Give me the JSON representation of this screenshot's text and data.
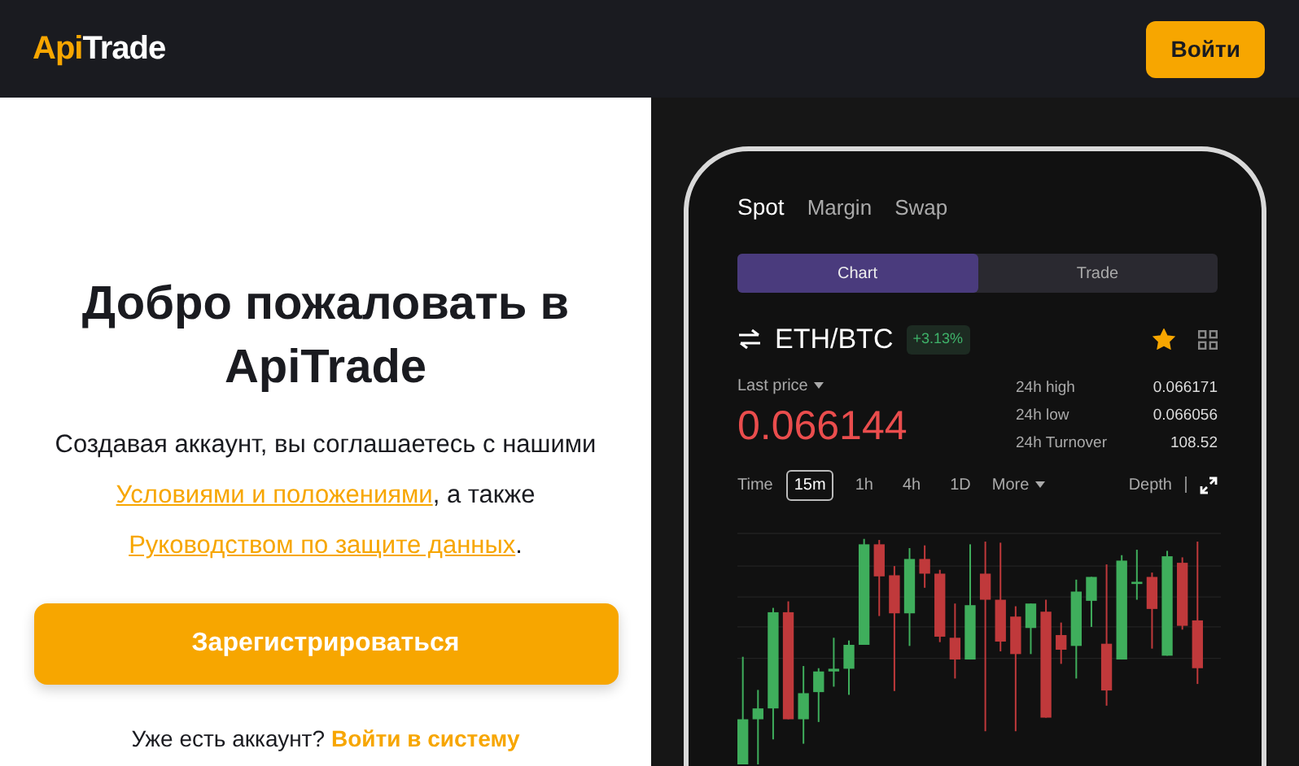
{
  "header": {
    "logo": {
      "accent": "Api",
      "rest": "Trade"
    },
    "login_button": "Войти"
  },
  "welcome": {
    "title": "Добро пожаловать в ApiTrade",
    "terms": [
      {
        "kind": "text",
        "text": "Создавая аккаунт, вы соглашаетесь с нашими "
      },
      {
        "kind": "link",
        "text": "Условиями и положениями"
      },
      {
        "kind": "text",
        "text": ", а также "
      },
      {
        "kind": "link",
        "text": "Руководством по защите данных"
      },
      {
        "kind": "text",
        "text": "."
      }
    ],
    "register_button": "Зарегистрироваться",
    "signin_prompt": "Уже есть аккаунт?",
    "signin_link": "Войти в систему"
  },
  "phone": {
    "tabs": [
      {
        "label": "Spot",
        "selected": true
      },
      {
        "label": "Margin",
        "selected": false
      },
      {
        "label": "Swap",
        "selected": false
      }
    ],
    "segments": [
      {
        "label": "Chart",
        "selected": true
      },
      {
        "label": "Trade",
        "selected": false
      }
    ],
    "pair": "ETH/BTC",
    "change": "+3.13%",
    "favorite": true,
    "last_price_label": "Last price",
    "last_price": "0.066144",
    "stats": [
      {
        "label": "24h high",
        "value": "0.066171"
      },
      {
        "label": "24h low",
        "value": "0.066056"
      },
      {
        "label": "24h Turnover",
        "value": "108.52"
      }
    ],
    "time_label": "Time",
    "intervals": [
      {
        "label": "15m",
        "selected": true
      },
      {
        "label": "1h",
        "selected": false
      },
      {
        "label": "4h",
        "selected": false
      },
      {
        "label": "1D",
        "selected": false
      }
    ],
    "more": "More",
    "depth": "Depth"
  }
}
